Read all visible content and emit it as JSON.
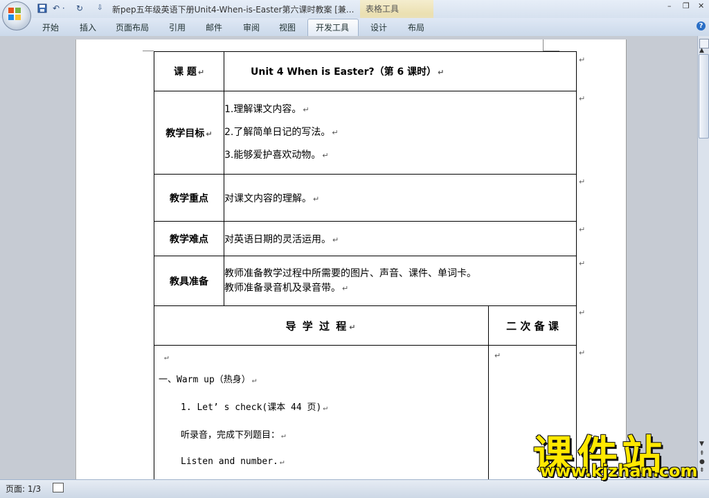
{
  "window": {
    "title": "新pep五年级英语下册Unit4-When-is-Easter第六课时教案 [兼...",
    "context_group": "表格工具",
    "minimize": "–",
    "restore": "❐",
    "close": "✕"
  },
  "quick_access": {
    "save_icon": "save-icon",
    "undo": "↶ ·",
    "redo": "↻",
    "more": "⇩"
  },
  "ribbon_tabs": [
    "开始",
    "插入",
    "页面布局",
    "引用",
    "邮件",
    "审阅",
    "视图",
    "开发工具",
    "设计",
    "布局"
  ],
  "active_tab": "开发工具",
  "help": "?",
  "table": {
    "topic_label": "课 题",
    "topic_value": "Unit 4  When is Easter?（第 6 课时）",
    "goals_label": "教学目标",
    "goals": [
      "1.理解课文内容。",
      "2.了解简单日记的写法。",
      "3.能够爱护喜欢动物。"
    ],
    "focus_label": "教学重点",
    "focus_value": "对课文内容的理解。",
    "difficulty_label": "教学难点",
    "difficulty_value": "对英语日期的灵活运用。",
    "prep_label": "教具准备",
    "prep_lines": [
      "教师准备教学过程中所需要的图片、声音、课件、单词卡。",
      "教师准备录音机及录音带。"
    ],
    "process_header": "导  学  过  程",
    "second_header": "二 次 备 课",
    "body_lines": [
      "一、Warm up（热身）",
      "1.  Let’ s check(课本 44 页)",
      "听录音，完成下列题目：",
      "Listen and number."
    ]
  },
  "paragraph_mark": "↵",
  "status": {
    "page": "页面: 1/3"
  },
  "watermark": {
    "brand": "课件站",
    "url": "www.kjzhan.com"
  }
}
